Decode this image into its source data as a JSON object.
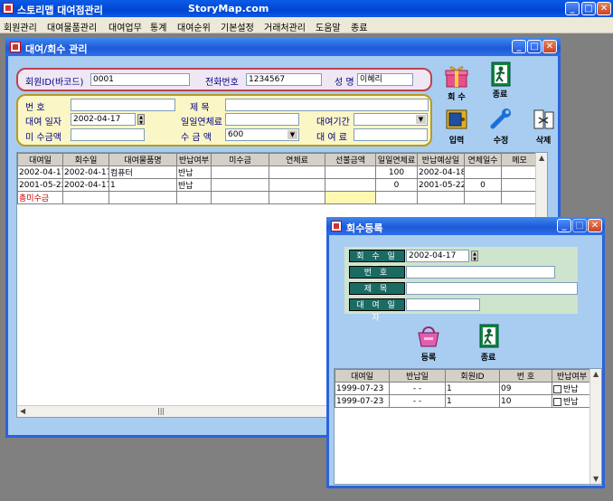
{
  "app": {
    "title": "스토리맵 대여점관리",
    "site": "StoryMap.com"
  },
  "menu": [
    "회원관리",
    "대여물품관리",
    "대여업무",
    "통계",
    "대여순위",
    "기본설정",
    "거래처관리",
    "도움말",
    "종료"
  ],
  "rental_window": {
    "title": "대여/회수 관리",
    "member_id_label": "회원ID(바코드)",
    "member_id": "0001",
    "phone_label": "전화번호",
    "phone": "1234567",
    "name_label": "성  명",
    "name": "이혜리",
    "item_no_label": "번     호",
    "item_no": "",
    "title_label": "제     목",
    "title_val": "",
    "rent_date_label": "대여 일자",
    "rent_date": "2002-04-17",
    "daily_fee_label": "일일연체료",
    "daily_fee": "",
    "period_label": "대여기간",
    "period": "",
    "unpaid_label": "미 수금액",
    "unpaid": "",
    "received_label": "수 금 액",
    "received": "600",
    "rent_fee_label": "대 여 료",
    "rent_fee": "",
    "buttons": {
      "return": "회 수",
      "exit": "종료",
      "enter": "입력",
      "edit": "수정",
      "delete": "삭제"
    },
    "grid": {
      "columns": [
        "대여일",
        "회수일",
        "대여물품명",
        "반납여부",
        "미수금",
        "연체료",
        "선불금액",
        "일일연체료",
        "반납예상일",
        "연체일수",
        "메모"
      ],
      "rows": [
        [
          "2002-04-17",
          "2002-04-17",
          "컴퓨터",
          "반납",
          "",
          "",
          "",
          "100",
          "2002-04-18",
          "",
          ""
        ],
        [
          "2001-05-22",
          "2002-04-17",
          "1",
          "반납",
          "",
          "",
          "",
          "0",
          "2001-05-22",
          "0",
          ""
        ]
      ],
      "total_label": "총미수금"
    }
  },
  "return_window": {
    "title": "회수등록",
    "return_date_label": "회 수 일 자",
    "return_date": "2002-04-17",
    "no_label": "번  호",
    "no": "",
    "title_label": "제  목",
    "title_val": "",
    "rent_date_label": "대 여 일 자",
    "rent_date": "",
    "buttons": {
      "register": "등록",
      "exit": "종료"
    },
    "grid": {
      "columns": [
        "대여일",
        "반납일",
        "회원ID",
        "번  호",
        "반납여부"
      ],
      "rows": [
        [
          "1999-07-23",
          "-  -",
          "1",
          "09",
          "반납"
        ],
        [
          "1999-07-23",
          "-  -",
          "1",
          "10",
          "반납"
        ]
      ]
    }
  }
}
